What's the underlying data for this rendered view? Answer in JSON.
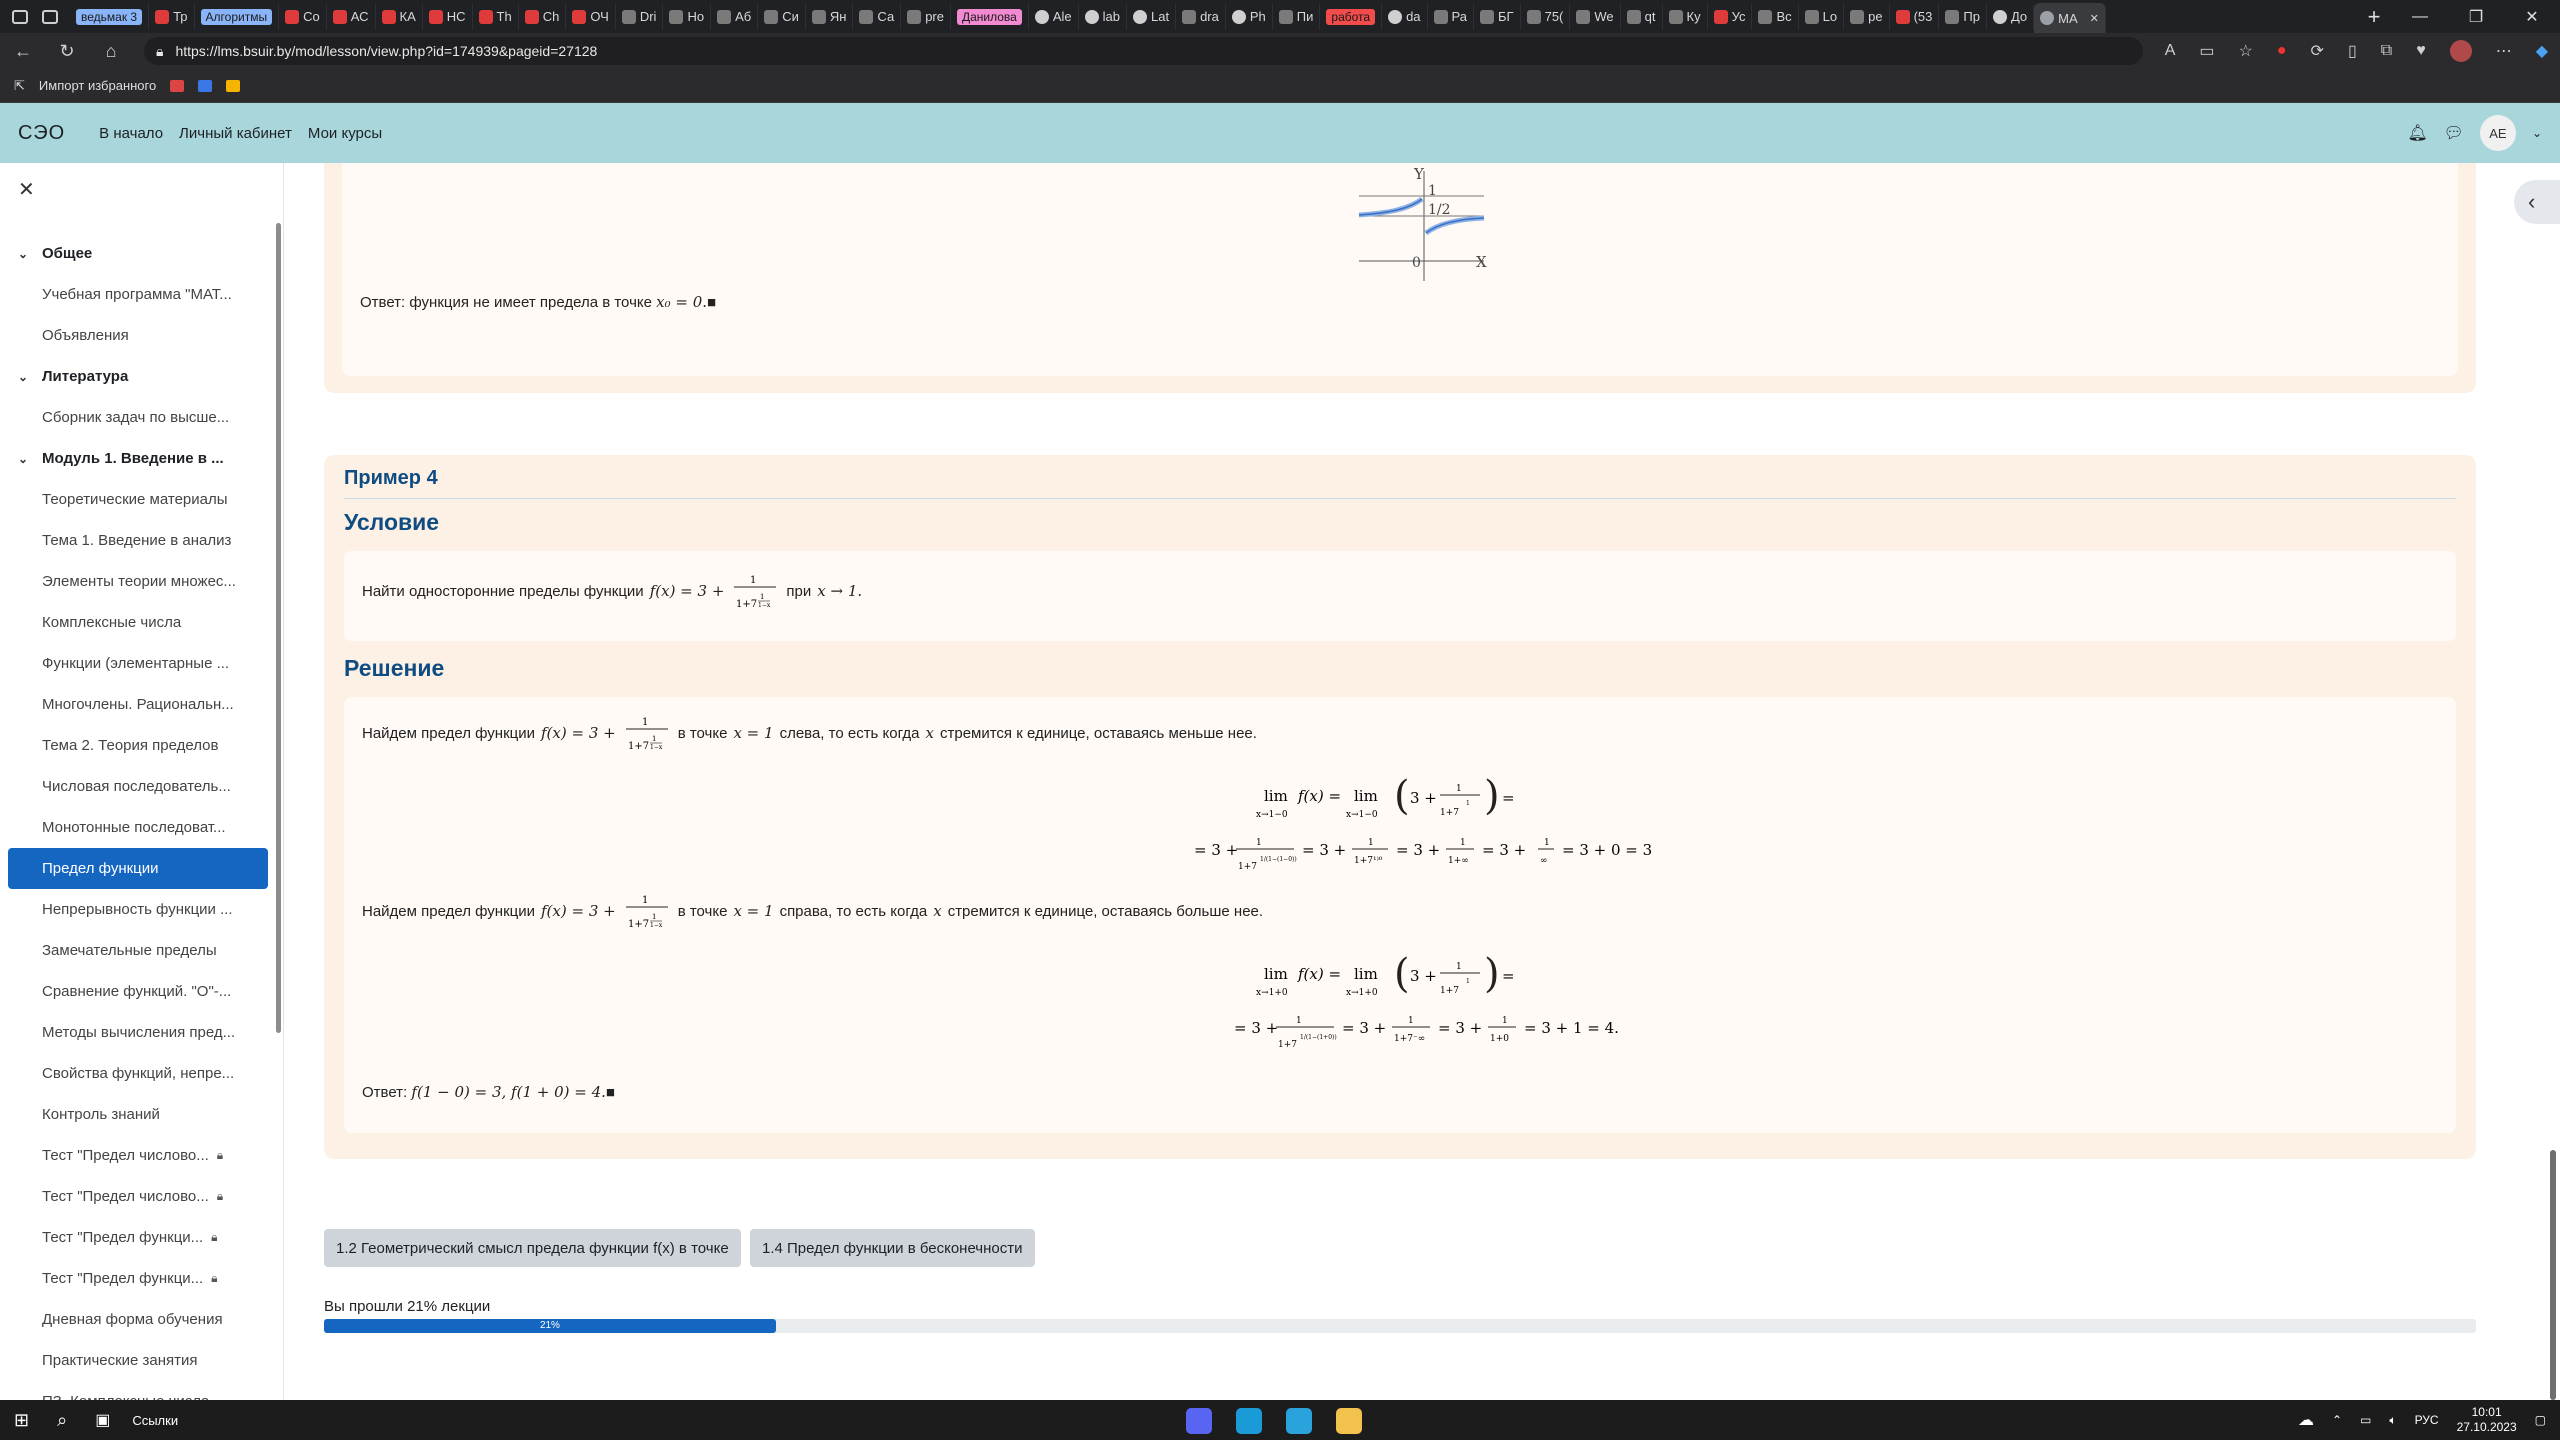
{
  "browser": {
    "tabs": [
      {
        "label": "ведьмак 3",
        "kind": "badge-blue"
      },
      {
        "label": "Тр",
        "kind": "yt"
      },
      {
        "label": "Алгоритмы",
        "kind": "badge-blue"
      },
      {
        "label": "Co",
        "kind": "yt"
      },
      {
        "label": "АС",
        "kind": "yt"
      },
      {
        "label": "КА",
        "kind": "yt"
      },
      {
        "label": "НС",
        "kind": "yt"
      },
      {
        "label": "Th",
        "kind": "yt"
      },
      {
        "label": "Ch",
        "kind": "yt"
      },
      {
        "label": "ОЧ",
        "kind": "yt"
      },
      {
        "label": "Dri",
        "kind": "gen"
      },
      {
        "label": "Но",
        "kind": "gen"
      },
      {
        "label": "Аб",
        "kind": "gen"
      },
      {
        "label": "Си",
        "kind": "gen"
      },
      {
        "label": "Ян",
        "kind": "gen"
      },
      {
        "label": "Са",
        "kind": "gen"
      },
      {
        "label": "pre",
        "kind": "gen"
      },
      {
        "label": "Данилова",
        "kind": "badge-pink"
      },
      {
        "label": "Ale",
        "kind": "gh"
      },
      {
        "label": "lab",
        "kind": "gh"
      },
      {
        "label": "Lat",
        "kind": "gh"
      },
      {
        "label": "dra",
        "kind": "gen"
      },
      {
        "label": "Ph",
        "kind": "gh"
      },
      {
        "label": "Пи",
        "kind": "gen"
      },
      {
        "label": "работа",
        "kind": "badge-red"
      },
      {
        "label": "da",
        "kind": "gh"
      },
      {
        "label": "Ра",
        "kind": "gen"
      },
      {
        "label": "БГ",
        "kind": "gen"
      },
      {
        "label": "75(",
        "kind": "gen"
      },
      {
        "label": "We",
        "kind": "gen"
      },
      {
        "label": "qt",
        "kind": "gen"
      },
      {
        "label": "Ку",
        "kind": "gen"
      },
      {
        "label": "Ус",
        "kind": "yt"
      },
      {
        "label": "Вс",
        "kind": "gen"
      },
      {
        "label": "Lo",
        "kind": "gen"
      },
      {
        "label": "ре",
        "kind": "gen"
      },
      {
        "label": "(53",
        "kind": "yt"
      },
      {
        "label": "Пр",
        "kind": "gen"
      },
      {
        "label": "До",
        "kind": "gh"
      },
      {
        "label": "МА",
        "kind": "active"
      }
    ],
    "url": "https://lms.bsuir.by/mod/lesson/view.php?id=174939&pageid=27128",
    "favorites": [
      "Импорт избранного"
    ],
    "colors": {
      "chrome": "#202124",
      "header": "#a8d6db",
      "accent": "#1566c0"
    }
  },
  "site": {
    "brand": "СЭО",
    "nav": [
      "В начало",
      "Личный кабинет",
      "Мои курсы"
    ],
    "user_initials": "AE"
  },
  "drawer": {
    "items": [
      {
        "type": "section",
        "label": "Общее"
      },
      {
        "type": "item",
        "label": "Учебная программа \"МАТ..."
      },
      {
        "type": "item",
        "label": "Объявления"
      },
      {
        "type": "section",
        "label": "Литература"
      },
      {
        "type": "item",
        "label": "Сборник задач по высше..."
      },
      {
        "type": "section",
        "label": "Модуль 1. Введение в ..."
      },
      {
        "type": "item",
        "label": "Теоретические материалы"
      },
      {
        "type": "item",
        "label": "Тема 1. Введение в анализ"
      },
      {
        "type": "item",
        "label": "Элементы теории множес..."
      },
      {
        "type": "item",
        "label": "Комплексные числа"
      },
      {
        "type": "item",
        "label": "Функции (элементарные ..."
      },
      {
        "type": "item",
        "label": "Многочлены. Рациональн..."
      },
      {
        "type": "item",
        "label": "Тема 2. Теория пределов"
      },
      {
        "type": "item",
        "label": "Числовая последователь..."
      },
      {
        "type": "item",
        "label": "Монотонные последоват..."
      },
      {
        "type": "item",
        "label": "Предел функции",
        "active": true
      },
      {
        "type": "item",
        "label": "Непрерывность функции ..."
      },
      {
        "type": "item",
        "label": "Замечательные пределы"
      },
      {
        "type": "item",
        "label": "Сравнение функций. \"О\"-..."
      },
      {
        "type": "item",
        "label": "Методы вычисления пред..."
      },
      {
        "type": "item",
        "label": "Свойства функций, непре..."
      },
      {
        "type": "item",
        "label": "Контроль знаний"
      },
      {
        "type": "item",
        "label": "Тест \"Предел числово...",
        "locked": true
      },
      {
        "type": "item",
        "label": "Тест \"Предел числово...",
        "locked": true
      },
      {
        "type": "item",
        "label": "Тест \"Предел функци...",
        "locked": true
      },
      {
        "type": "item",
        "label": "Тест \"Предел функци...",
        "locked": true
      },
      {
        "type": "item",
        "label": "Дневная форма обучения"
      },
      {
        "type": "item",
        "label": "Практические занятия"
      },
      {
        "type": "item",
        "label": "ПЗ. Комплексные числа"
      }
    ]
  },
  "content": {
    "graph": {
      "y_label": "Y",
      "x_label": "X",
      "tick_1": "1",
      "tick_half": "1/2",
      "origin": "0"
    },
    "prev_answer": {
      "prefix": "Ответ: функция не имеет предела в точке",
      "math": "x₀ = 0.",
      "qed": "■"
    },
    "example": {
      "title": "Пример 4",
      "condition_heading": "Условие",
      "condition": {
        "prefix": "Найти односторонние пределы функции",
        "f": "f(x) = 3 +",
        "mid": "при",
        "tail": "x → 1."
      },
      "solution_heading": "Решение",
      "left": {
        "prefix": "Найдем предел функции",
        "f": "f(x) = 3 +",
        "mid": "в точке",
        "point": "x = 1",
        "text": "слева, то есть когда",
        "var": "x",
        "tail": "стремится к единице, оставаясь меньше нее.",
        "sub": "x→1−0",
        "chain": [
          "= 3 +",
          "= 3 +",
          "= 3 +",
          "= 3 +",
          "= 3 + 0 = 3"
        ]
      },
      "right": {
        "prefix": "Найдем предел функции",
        "f": "f(x) = 3 +",
        "mid": "в точке",
        "point": "x = 1",
        "text": "справа, то есть когда",
        "var": "x",
        "tail": "стремится к единице, оставаясь больше нее.",
        "sub": "x→1+0",
        "chain": [
          "= 3 +",
          "= 3 +",
          "= 3 +",
          "= 3 + 1 = 4."
        ]
      },
      "answer": {
        "prefix": "Ответ:",
        "math": "f(1 − 0) = 3,  f(1 + 0) = 4.",
        "qed": "■"
      }
    },
    "nav": {
      "prev": "1.2 Геометрический смысл предела функции f(x) в точке",
      "next": "1.4 Предел функции в бесконечности"
    },
    "progress": {
      "text": "Вы прошли 21% лекции",
      "label": "21%",
      "fraction": 0.21
    }
  },
  "taskbar": {
    "search": "Ссылки",
    "lang": "РУС",
    "time": "10:01",
    "date": "27.10.2023"
  }
}
